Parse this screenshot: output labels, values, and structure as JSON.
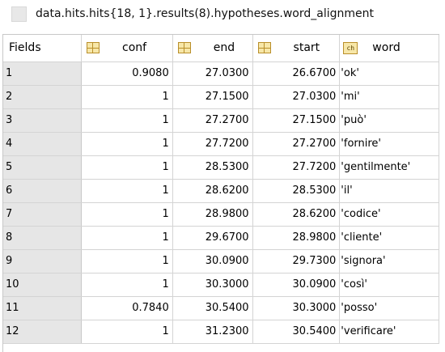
{
  "window": {
    "title": "data.hits.hits{18, 1}.results(8).hypotheses.word_alignment"
  },
  "table": {
    "corner_label": "Fields",
    "columns": [
      {
        "label": "conf",
        "icon": "numeric-variable-icon"
      },
      {
        "label": "end",
        "icon": "numeric-variable-icon"
      },
      {
        "label": "start",
        "icon": "numeric-variable-icon"
      },
      {
        "label": "word",
        "icon": "char-array-icon"
      }
    ],
    "rows": [
      {
        "index": "1",
        "conf": "0.9080",
        "end": "27.0300",
        "start": "26.6700",
        "word": "'ok'"
      },
      {
        "index": "2",
        "conf": "1",
        "end": "27.1500",
        "start": "27.0300",
        "word": "'mi'"
      },
      {
        "index": "3",
        "conf": "1",
        "end": "27.2700",
        "start": "27.1500",
        "word": "'può'"
      },
      {
        "index": "4",
        "conf": "1",
        "end": "27.7200",
        "start": "27.2700",
        "word": "'fornire'"
      },
      {
        "index": "5",
        "conf": "1",
        "end": "28.5300",
        "start": "27.7200",
        "word": "'gentilmente'"
      },
      {
        "index": "6",
        "conf": "1",
        "end": "28.6200",
        "start": "28.5300",
        "word": "'il'"
      },
      {
        "index": "7",
        "conf": "1",
        "end": "28.9800",
        "start": "28.6200",
        "word": "'codice'"
      },
      {
        "index": "8",
        "conf": "1",
        "end": "29.6700",
        "start": "28.9800",
        "word": "'cliente'"
      },
      {
        "index": "9",
        "conf": "1",
        "end": "30.0900",
        "start": "29.7300",
        "word": "'signora'"
      },
      {
        "index": "10",
        "conf": "1",
        "end": "30.3000",
        "start": "30.0900",
        "word": "'così'"
      },
      {
        "index": "11",
        "conf": "0.7840",
        "end": "30.5400",
        "start": "30.3000",
        "word": "'posso'"
      },
      {
        "index": "12",
        "conf": "1",
        "end": "31.2300",
        "start": "30.5400",
        "word": "'verificare'"
      }
    ]
  }
}
